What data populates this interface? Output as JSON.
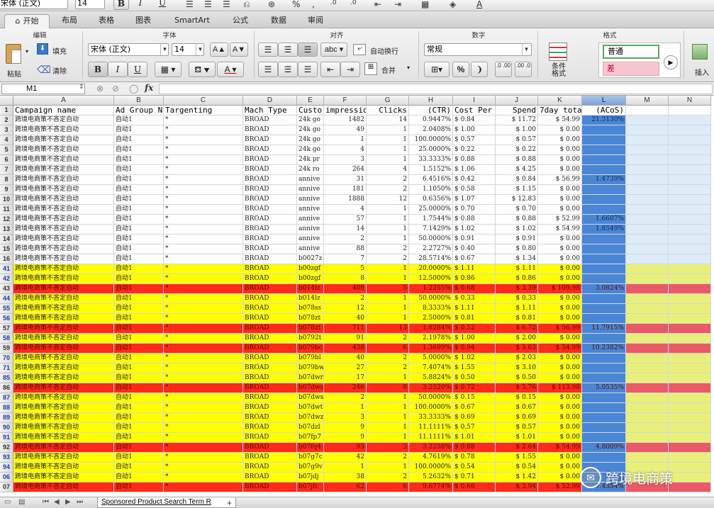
{
  "format_bar": {
    "font_name": "宋体 (正文)",
    "font_size": "14",
    "bold": "B",
    "italic": "I",
    "underline": "U"
  },
  "ribbon_tabs": [
    "开始",
    "布局",
    "表格",
    "图表",
    "SmartArt",
    "公式",
    "数据",
    "审阅"
  ],
  "ribbon": {
    "groups": {
      "edit": "编辑",
      "font": "字体",
      "align": "对齐",
      "number": "数字",
      "format": "格式"
    },
    "paste_label": "粘贴",
    "fill_label": "填充",
    "clear_label": "清除",
    "font_name": "宋体 (正文)",
    "font_size": "14",
    "increase_font": "A▲",
    "decrease_font": "A▼",
    "bold": "B",
    "italic": "I",
    "underline": "U",
    "abc_label": "abc",
    "wrap_label": "自动换行",
    "merge_label": "合并",
    "number_format": "常规",
    "percent": "%",
    "comma": "❩",
    "inc_decimal": ".0 .00",
    "dec_decimal": ".00 .0",
    "cond_format_label": "条件\n格式",
    "style_normal": "普通",
    "style_bad": "差",
    "insert_label": "插入"
  },
  "formula_bar": {
    "name_box": "M1",
    "fx": "fx",
    "formula": ""
  },
  "columns": [
    "A",
    "B",
    "C",
    "D",
    "E",
    "F",
    "G",
    "H",
    "I",
    "J",
    "K",
    "L",
    "M",
    "N"
  ],
  "selected_column": "L",
  "header_row": {
    "row_label": "1",
    "cells": [
      "Campaign name",
      "Ad Group N",
      "Targenting",
      "Mach Type",
      "Custo",
      "impressio",
      "Clicks",
      "(CTR)",
      "Cost Per",
      "Spend",
      "7day tota",
      "(ACoS)",
      "",
      ""
    ]
  },
  "rows": [
    {
      "n": "2",
      "style": "",
      "blue": false,
      "cells": [
        "跨境电商策不吝定自动",
        "自动1",
        "*",
        "BROAD",
        "24k go",
        "1482",
        "14",
        "0.9447%",
        "$ 0.84",
        "$ 11.72",
        "$ 54.99",
        "21.3130%"
      ]
    },
    {
      "n": "3",
      "style": "",
      "blue": false,
      "cells": [
        "跨境电商策不吝定自动",
        "自动1",
        "*",
        "BROAD",
        "24k go",
        "49",
        "1",
        "2.0408%",
        "$ 1.00",
        "$ 1.00",
        "$ 0.00",
        ""
      ]
    },
    {
      "n": "4",
      "style": "",
      "blue": false,
      "cells": [
        "跨境电商策不吝定自动",
        "自动1",
        "*",
        "BROAD",
        "24k go",
        "1",
        "1",
        "100.0000%",
        "$ 0.57",
        "$ 0.57",
        "$ 0.00",
        ""
      ]
    },
    {
      "n": "5",
      "style": "",
      "blue": false,
      "cells": [
        "跨境电商策不吝定自动",
        "自动1",
        "*",
        "BROAD",
        "24k go",
        "4",
        "1",
        "25.0000%",
        "$ 0.22",
        "$ 0.22",
        "$ 0.00",
        ""
      ]
    },
    {
      "n": "6",
      "style": "",
      "blue": false,
      "cells": [
        "跨境电商策不吝定自动",
        "自动1",
        "*",
        "BROAD",
        "24k pr",
        "3",
        "1",
        "33.3333%",
        "$ 0.88",
        "$ 0.88",
        "$ 0.00",
        ""
      ]
    },
    {
      "n": "7",
      "style": "",
      "blue": false,
      "cells": [
        "跨境电商策不吝定自动",
        "自动1",
        "*",
        "BROAD",
        "24k ro",
        "264",
        "4",
        "1.5152%",
        "$ 1.06",
        "$ 4.25",
        "$ 0.00",
        ""
      ]
    },
    {
      "n": "8",
      "style": "",
      "blue": false,
      "cells": [
        "跨境电商策不吝定自动",
        "自动1",
        "*",
        "BROAD",
        "annive",
        "31",
        "2",
        "6.4516%",
        "$ 0.42",
        "$ 0.84",
        "$ 56.99",
        "1.4739%"
      ]
    },
    {
      "n": "9",
      "style": "",
      "blue": false,
      "cells": [
        "跨境电商策不吝定自动",
        "自动1",
        "*",
        "BROAD",
        "annive",
        "181",
        "2",
        "1.1050%",
        "$ 0.58",
        "$ 1.15",
        "$ 0.00",
        ""
      ]
    },
    {
      "n": "10",
      "style": "",
      "blue": false,
      "cells": [
        "跨境电商策不吝定自动",
        "自动1",
        "*",
        "BROAD",
        "annive",
        "1888",
        "12",
        "0.6356%",
        "$ 1.07",
        "$ 12.83",
        "$ 0.00",
        ""
      ]
    },
    {
      "n": "11",
      "style": "",
      "blue": false,
      "cells": [
        "跨境电商策不吝定自动",
        "自动1",
        "*",
        "BROAD",
        "annive",
        "4",
        "1",
        "25.0000%",
        "$ 0.70",
        "$ 0.70",
        "$ 0.00",
        ""
      ]
    },
    {
      "n": "12",
      "style": "",
      "blue": false,
      "cells": [
        "跨境电商策不吝定自动",
        "自动1",
        "*",
        "BROAD",
        "annive",
        "57",
        "1",
        "1.7544%",
        "$ 0.88",
        "$ 0.88",
        "$ 52.99",
        "1.6607%"
      ]
    },
    {
      "n": "13",
      "style": "",
      "blue": false,
      "cells": [
        "跨境电商策不吝定自动",
        "自动1",
        "*",
        "BROAD",
        "annive",
        "14",
        "1",
        "7.1429%",
        "$ 1.02",
        "$ 1.02",
        "$ 54.99",
        "1.8549%"
      ]
    },
    {
      "n": "14",
      "style": "",
      "blue": false,
      "cells": [
        "跨境电商策不吝定自动",
        "自动1",
        "*",
        "BROAD",
        "annive",
        "2",
        "1",
        "50.0000%",
        "$ 0.91",
        "$ 0.91",
        "$ 0.00",
        ""
      ]
    },
    {
      "n": "15",
      "style": "",
      "blue": false,
      "cells": [
        "跨境电商策不吝定自动",
        "自动1",
        "*",
        "BROAD",
        "annive",
        "88",
        "2",
        "2.2727%",
        "$ 0.40",
        "$ 0.80",
        "$ 0.00",
        ""
      ]
    },
    {
      "n": "16",
      "style": "",
      "blue": false,
      "cells": [
        "跨境电商策不吝定自动",
        "自动1",
        "*",
        "BROAD",
        "b0027z",
        "7",
        "2",
        "28.5714%",
        "$ 0.67",
        "$ 1.34",
        "$ 0.00",
        ""
      ]
    },
    {
      "n": "41",
      "style": "yellow",
      "blue": true,
      "cells": [
        "跨境电商策不吝定自动",
        "自动1",
        "*",
        "BROAD",
        "b00zgf",
        "5",
        "1",
        "20.0000%",
        "$ 1.11",
        "$ 1.11",
        "$ 0.00",
        ""
      ]
    },
    {
      "n": "42",
      "style": "yellow",
      "blue": true,
      "cells": [
        "跨境电商策不吝定自动",
        "自动1",
        "*",
        "BROAD",
        "b00zgf",
        "8",
        "1",
        "12.5000%",
        "$ 0.86",
        "$ 0.86",
        "$ 0.00",
        ""
      ]
    },
    {
      "n": "43",
      "style": "red",
      "blue": false,
      "cells": [
        "跨境电商策不吝定自动",
        "自动1",
        "*",
        "BROAD",
        "b014lz",
        "408",
        "5",
        "1.2255%",
        "$ 0.68",
        "$ 3.39",
        "$ 109.98",
        "3.0824%"
      ]
    },
    {
      "n": "44",
      "style": "yellow",
      "blue": true,
      "cells": [
        "跨境电商策不吝定自动",
        "自动1",
        "*",
        "BROAD",
        "b014lz",
        "2",
        "1",
        "50.0000%",
        "$ 0.33",
        "$ 0.33",
        "$ 0.00",
        ""
      ]
    },
    {
      "n": "55",
      "style": "yellow",
      "blue": true,
      "cells": [
        "跨境电商策不吝定自动",
        "自动1",
        "*",
        "BROAD",
        "b078ss",
        "12",
        "1",
        "8.3333%",
        "$ 1.11",
        "$ 1.11",
        "$ 0.00",
        ""
      ]
    },
    {
      "n": "56",
      "style": "yellow",
      "blue": true,
      "cells": [
        "跨境电商策不吝定自动",
        "自动1",
        "*",
        "BROAD",
        "b078zt",
        "40",
        "1",
        "2.5000%",
        "$ 0.81",
        "$ 0.81",
        "$ 0.00",
        ""
      ]
    },
    {
      "n": "57",
      "style": "red",
      "blue": false,
      "cells": [
        "跨境电商策不吝定自动",
        "自动1",
        "*",
        "BROAD",
        "b078zt",
        "711",
        "13",
        "1.8284%",
        "$ 0.52",
        "$ 6.72",
        "$ 56.99",
        "11.7915%"
      ]
    },
    {
      "n": "58",
      "style": "yellow",
      "blue": true,
      "cells": [
        "跨境电商策不吝定自动",
        "自动1",
        "*",
        "BROAD",
        "b0792t",
        "91",
        "2",
        "2.1978%",
        "$ 1.00",
        "$ 2.00",
        "$ 0.00",
        ""
      ]
    },
    {
      "n": "59",
      "style": "red",
      "blue": false,
      "cells": [
        "跨境电商策不吝定自动",
        "自动1",
        "*",
        "BROAD",
        "b079bc",
        "438",
        "6",
        "1.3699%",
        "$ 0.94",
        "$ 5.63",
        "$ 54.99",
        "10.2382%"
      ]
    },
    {
      "n": "70",
      "style": "yellow",
      "blue": true,
      "cells": [
        "跨境电商策不吝定自动",
        "自动1",
        "*",
        "BROAD",
        "b079bl",
        "40",
        "2",
        "5.0000%",
        "$ 1.02",
        "$ 2.03",
        "$ 0.00",
        ""
      ]
    },
    {
      "n": "71",
      "style": "yellow",
      "blue": true,
      "cells": [
        "跨境电商策不吝定自动",
        "自动1",
        "*",
        "BROAD",
        "b079bw",
        "27",
        "2",
        "7.4074%",
        "$ 1.55",
        "$ 3.10",
        "$ 0.00",
        ""
      ]
    },
    {
      "n": "85",
      "style": "yellow",
      "blue": true,
      "cells": [
        "跨境电商策不吝定自动",
        "自动1",
        "*",
        "BROAD",
        "b07dwr",
        "17",
        "1",
        "5.8824%",
        "$ 0.50",
        "$ 0.50",
        "$ 0.00",
        ""
      ]
    },
    {
      "n": "86",
      "style": "red",
      "blue": false,
      "cells": [
        "跨境电商策不吝定自动",
        "自动1",
        "*",
        "BROAD",
        "b07dws",
        "246",
        "8",
        "3.2520%",
        "$ 0.72",
        "$ 5.76",
        "$ 113.98",
        "5.0535%"
      ]
    },
    {
      "n": "87",
      "style": "yellow",
      "blue": true,
      "cells": [
        "跨境电商策不吝定自动",
        "自动1",
        "*",
        "BROAD",
        "b07dws",
        "2",
        "1",
        "50.0000%",
        "$ 0.15",
        "$ 0.15",
        "$ 0.00",
        ""
      ]
    },
    {
      "n": "88",
      "style": "yellow",
      "blue": true,
      "cells": [
        "跨境电商策不吝定自动",
        "自动1",
        "*",
        "BROAD",
        "b07dwt",
        "1",
        "1",
        "100.0000%",
        "$ 0.67",
        "$ 0.67",
        "$ 0.00",
        ""
      ]
    },
    {
      "n": "89",
      "style": "yellow",
      "blue": true,
      "cells": [
        "跨境电商策不吝定自动",
        "自动1",
        "*",
        "BROAD",
        "b07dwz",
        "3",
        "1",
        "33.3333%",
        "$ 0.69",
        "$ 0.69",
        "$ 0.00",
        ""
      ]
    },
    {
      "n": "90",
      "style": "yellow",
      "blue": true,
      "cells": [
        "跨境电商策不吝定自动",
        "自动1",
        "*",
        "BROAD",
        "b07dzl",
        "9",
        "1",
        "11.1111%",
        "$ 0.57",
        "$ 0.57",
        "$ 0.00",
        ""
      ]
    },
    {
      "n": "91",
      "style": "yellow",
      "blue": true,
      "cells": [
        "跨境电商策不吝定自动",
        "自动1",
        "*",
        "BROAD",
        "b07fp7",
        "9",
        "1",
        "11.1111%",
        "$ 1.01",
        "$ 1.01",
        "$ 0.00",
        ""
      ]
    },
    {
      "n": "92",
      "style": "red",
      "blue": false,
      "cells": [
        "跨境电商策不吝定自动",
        "自动1",
        "*",
        "BROAD",
        "b07fq4",
        "93",
        "3",
        "3.2258%",
        "$ 0.88",
        "$ 2.64",
        "$ 54.99",
        "4.8009%"
      ]
    },
    {
      "n": "93",
      "style": "yellow",
      "blue": true,
      "cells": [
        "跨境电商策不吝定自动",
        "自动1",
        "*",
        "BROAD",
        "b07g7c",
        "42",
        "2",
        "4.7619%",
        "$ 0.78",
        "$ 1.55",
        "$ 0.00",
        ""
      ]
    },
    {
      "n": "94",
      "style": "yellow",
      "blue": true,
      "cells": [
        "跨境电商策不吝定自动",
        "自动1",
        "*",
        "BROAD",
        "b07g9v",
        "1",
        "1",
        "100.0000%",
        "$ 0.54",
        "$ 0.54",
        "$ 0.00",
        ""
      ]
    },
    {
      "n": "06",
      "style": "yellow",
      "blue": true,
      "cells": [
        "跨境电商策不吝定自动",
        "自动1",
        "*",
        "BROAD",
        "b07jdj",
        "38",
        "2",
        "5.2632%",
        "$ 0.71",
        "$ 1.42",
        "$ 0.00",
        ""
      ]
    },
    {
      "n": "07",
      "style": "red",
      "blue": false,
      "cells": [
        "跨境电商策不吝定自动",
        "自动1",
        "*",
        "BROAD",
        "b07jfc",
        "62",
        "6",
        "9.6774%",
        "$ 0.66",
        "$ 3.94",
        "$ 52.99",
        "7.4354%"
      ]
    }
  ],
  "sheet_tab": "Sponsored Product Search Term R",
  "add_sheet": "+",
  "watermark": "跨境电商策",
  "colors": {
    "yellow_row": "#ffff00",
    "red_row": "#ff2a1a",
    "col_L": "#4a86d6",
    "selection_header": "#7fa3d8"
  }
}
